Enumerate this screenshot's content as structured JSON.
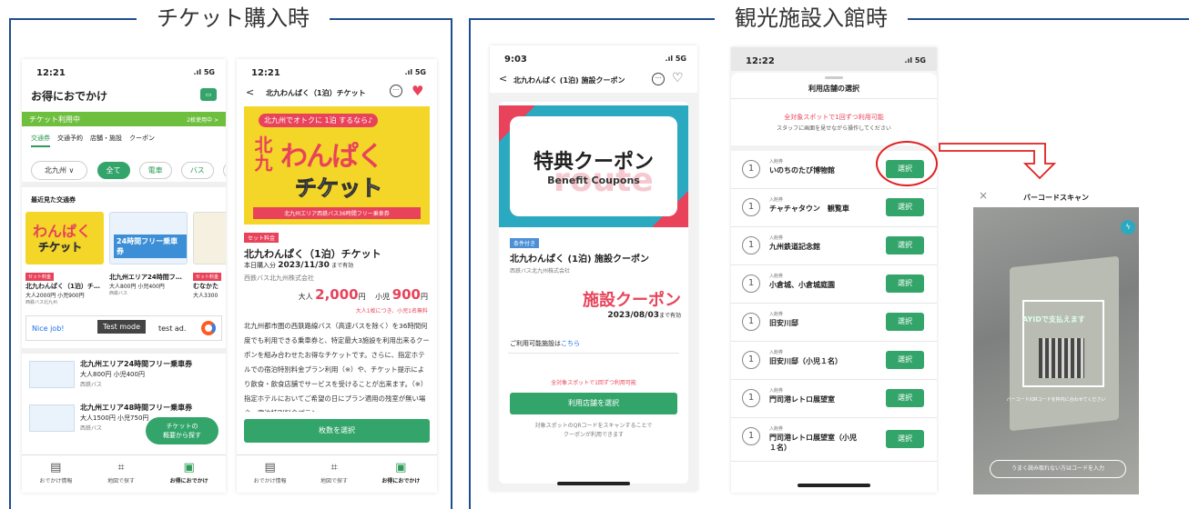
{
  "sections": {
    "left": "チケット購入時",
    "right": "観光施設入館時"
  },
  "screen1": {
    "time": "12:21",
    "signal": ".ıl 5G",
    "title": "お得におでかけ",
    "banner": "チケット利用中",
    "banner_right": "2枚使用中 >",
    "tabs": [
      "交通券",
      "交通予約",
      "店舗・施設",
      "クーポン"
    ],
    "region": "北九州",
    "chips": [
      "全て",
      "電車",
      "バス",
      "船"
    ],
    "recent": "最近見た交通券",
    "cards": [
      {
        "tag": "セット料金",
        "name": "北九わんぱく（1泊）チ…",
        "price": "大人2000円 小児900円",
        "co": "西鉄バス北九州"
      },
      {
        "tag": "",
        "name": "北九州エリア24時間フ…",
        "price": "大人800円 小児400円",
        "co": "西鉄バス"
      },
      {
        "tag": "セット料金",
        "name": "むなかた",
        "price": "大人3300",
        "co": ""
      }
    ],
    "ad_nice": "Nice job!",
    "ad_mode": "Test mode",
    "ad_text": "test ad.",
    "list": [
      {
        "name": "北九州エリア24時間フリー乗車券",
        "price": "大人800円 小児400円",
        "co": "西鉄バス"
      },
      {
        "name": "北九州エリア48時間フリー乗車券",
        "price": "大人1500円 小児750円",
        "co": "西鉄バス"
      }
    ],
    "fab": "チケットの\n概要から探す",
    "nav": [
      "おでかけ情報",
      "地図で探す",
      "お得におでかけ"
    ]
  },
  "screen2": {
    "time": "12:21",
    "back": "<",
    "title": "北九わんぱく（1泊）チケット",
    "hero_top": "北九州でオトクに 1泊 するなら♪",
    "hero_a": "わんぱく",
    "hero_b": "チケット",
    "hero_c": "北九",
    "hero_strip": "北九州エリア西鉄バス36時間フリー乗車券",
    "tag": "セット料金",
    "name": "北九わんぱく（1泊）チケット",
    "period_pre": "本日購入分",
    "period": "2023/11/30",
    "period_post": "まで有効",
    "company": "西鉄バス北九州株式会社",
    "adult_l": "大人",
    "adult": "2,000",
    "yen": "円",
    "child_l": "小児",
    "child": "900",
    "yen2": "円",
    "free": "大人1枚につき、小児1名無料",
    "desc": "北九州都市圏の西鉄路線バス（高速バスを除く）を36時間何度でも利用できる乗車券と、特定最大3施設を利用出来るクーポンを組み合わせたお得なチケットです。さらに、指定ホテルでの宿泊特別料金プラン利用（※）や、チケット提示により飲食・飲食店舗でサービスを受けることが出来ます。（※）指定ホテルにおいてご希望の日にプラン適用の残室が無い場合、宿泊特別料金プラン",
    "button": "枚数を選択",
    "nav": [
      "おでかけ情報",
      "地図で探す",
      "お得におでかけ"
    ]
  },
  "screen3": {
    "time": "9:03",
    "title": "北九わんぱく (1泊) 施設クーポン",
    "coupon_jp": "特典クーポン",
    "coupon_en": "Benefit Coupons",
    "coupon_wm": "route",
    "tag": "条件付き",
    "name": "北九わんぱく (1泊) 施設クーポン",
    "company": "西鉄バス北九州株式会社",
    "big": "施設クーポン",
    "valid": "2023/08/03",
    "valid_post": "まで有効",
    "avail": "ご利用可能施設は",
    "avail_link": "こちら",
    "notice": "全対象スポットで1回ずつ利用可能",
    "button": "利用店舗を選択",
    "foot": "対象スポットのQRコードをスキャンすることで\nクーポンが利用できます"
  },
  "screen4": {
    "time": "12:22",
    "title": "利用店舗の選択",
    "notice": "全対象スポットで1回ずつ利用可能",
    "sub": "スタッフに画面を見せながら操作してください",
    "label": "入館券",
    "select": "選択",
    "badge": "1",
    "stores": [
      "いのちのたび博物館",
      "チャチャタウン　観覧車",
      "九州鉄道記念館",
      "小倉城、小倉城庭園",
      "旧安川邸",
      "旧安川邸（小児１名）",
      "門司港レトロ展望室",
      "門司港レトロ展望室（小児\n１名）"
    ]
  },
  "screen5": {
    "close": "×",
    "title": "バーコードスキャン",
    "manual": "うまく読み取れない方はコードを入力",
    "hint": "バーコード/QRコードを枠内に合わせてください",
    "scan_text": "AYIDで支払えます"
  },
  "colors": {
    "green": "#34a56a",
    "red": "#e8435a",
    "blue": "#1f4e8c"
  }
}
